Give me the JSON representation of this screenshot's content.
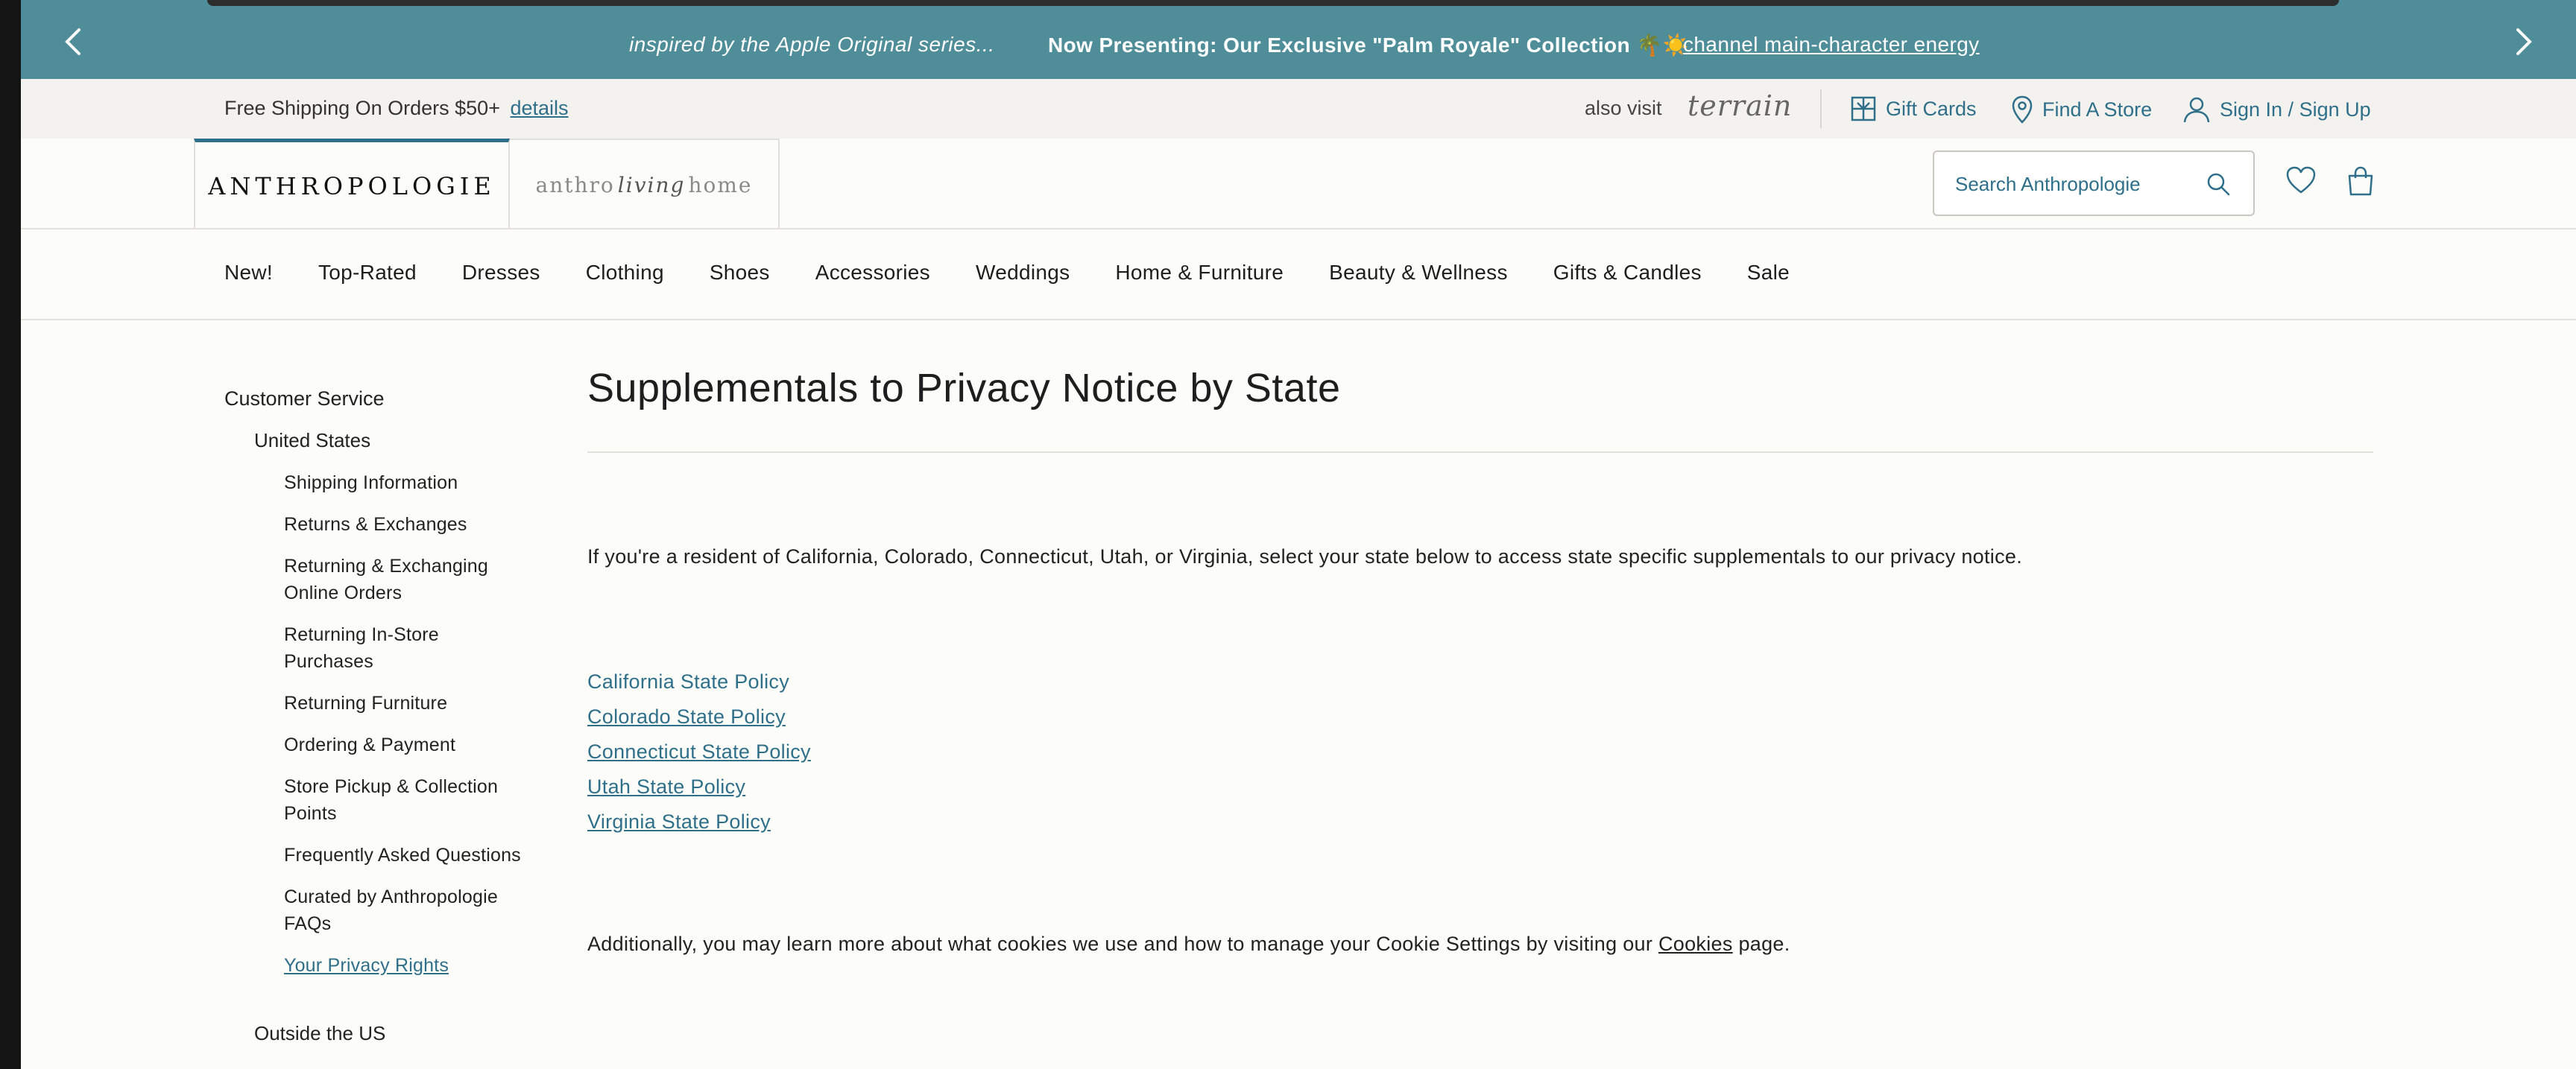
{
  "promo": {
    "message1": "inspired by the Apple Original series...",
    "message2": "Now Presenting: Our Exclusive \"Palm Royale\" Collection 🌴☀️",
    "link": "channel main-character energy",
    "prev_icon": "chevron-left-icon",
    "next_icon": "chevron-right-icon",
    "background": "#4f8d99"
  },
  "utility": {
    "shipping_text": "Free Shipping On Orders $50+",
    "shipping_link": "details",
    "also_visit": "also visit",
    "terrain": "terrain",
    "gift_cards": "Gift Cards",
    "find_store": "Find A Store",
    "sign_in": "Sign In / Sign Up"
  },
  "header": {
    "brand": "ANTHROPOLOGIE",
    "living_left": "anthro",
    "living_script": "living",
    "living_right": "home",
    "search_placeholder": "Search Anthropologie",
    "accent": "#2f6f8a"
  },
  "nav": {
    "items": [
      "New!",
      "Top-Rated",
      "Dresses",
      "Clothing",
      "Shoes",
      "Accessories",
      "Weddings",
      "Home & Furniture",
      "Beauty & Wellness",
      "Gifts & Candles",
      "Sale"
    ]
  },
  "sidebar": {
    "title": "Customer Service",
    "region": "United States",
    "items": [
      "Shipping Information",
      "Returns & Exchanges",
      "Returning & Exchanging Online Orders",
      "Returning In-Store Purchases",
      "Returning Furniture",
      "Ordering & Payment",
      "Store Pickup & Collection Points",
      "Frequently Asked Questions",
      "Curated by Anthropologie FAQs",
      "Your Privacy Rights"
    ],
    "active_item": "Your Privacy Rights",
    "outside": "Outside the US"
  },
  "main": {
    "title": "Supplementals to Privacy Notice by State",
    "intro": "If you're a resident of California, Colorado, Connecticut, Utah, or Virginia, select your state below to access state specific supplementals to our privacy notice.",
    "links": [
      "California State Policy",
      "Colorado State Policy",
      "Connecticut State Policy",
      "Utah State Policy",
      "Virginia State Policy"
    ],
    "cookies_before": "Additionally, you may learn more about what cookies we use and how to manage your Cookie Settings by visiting our",
    "cookies_link": "Cookies",
    "cookies_after": "page."
  }
}
